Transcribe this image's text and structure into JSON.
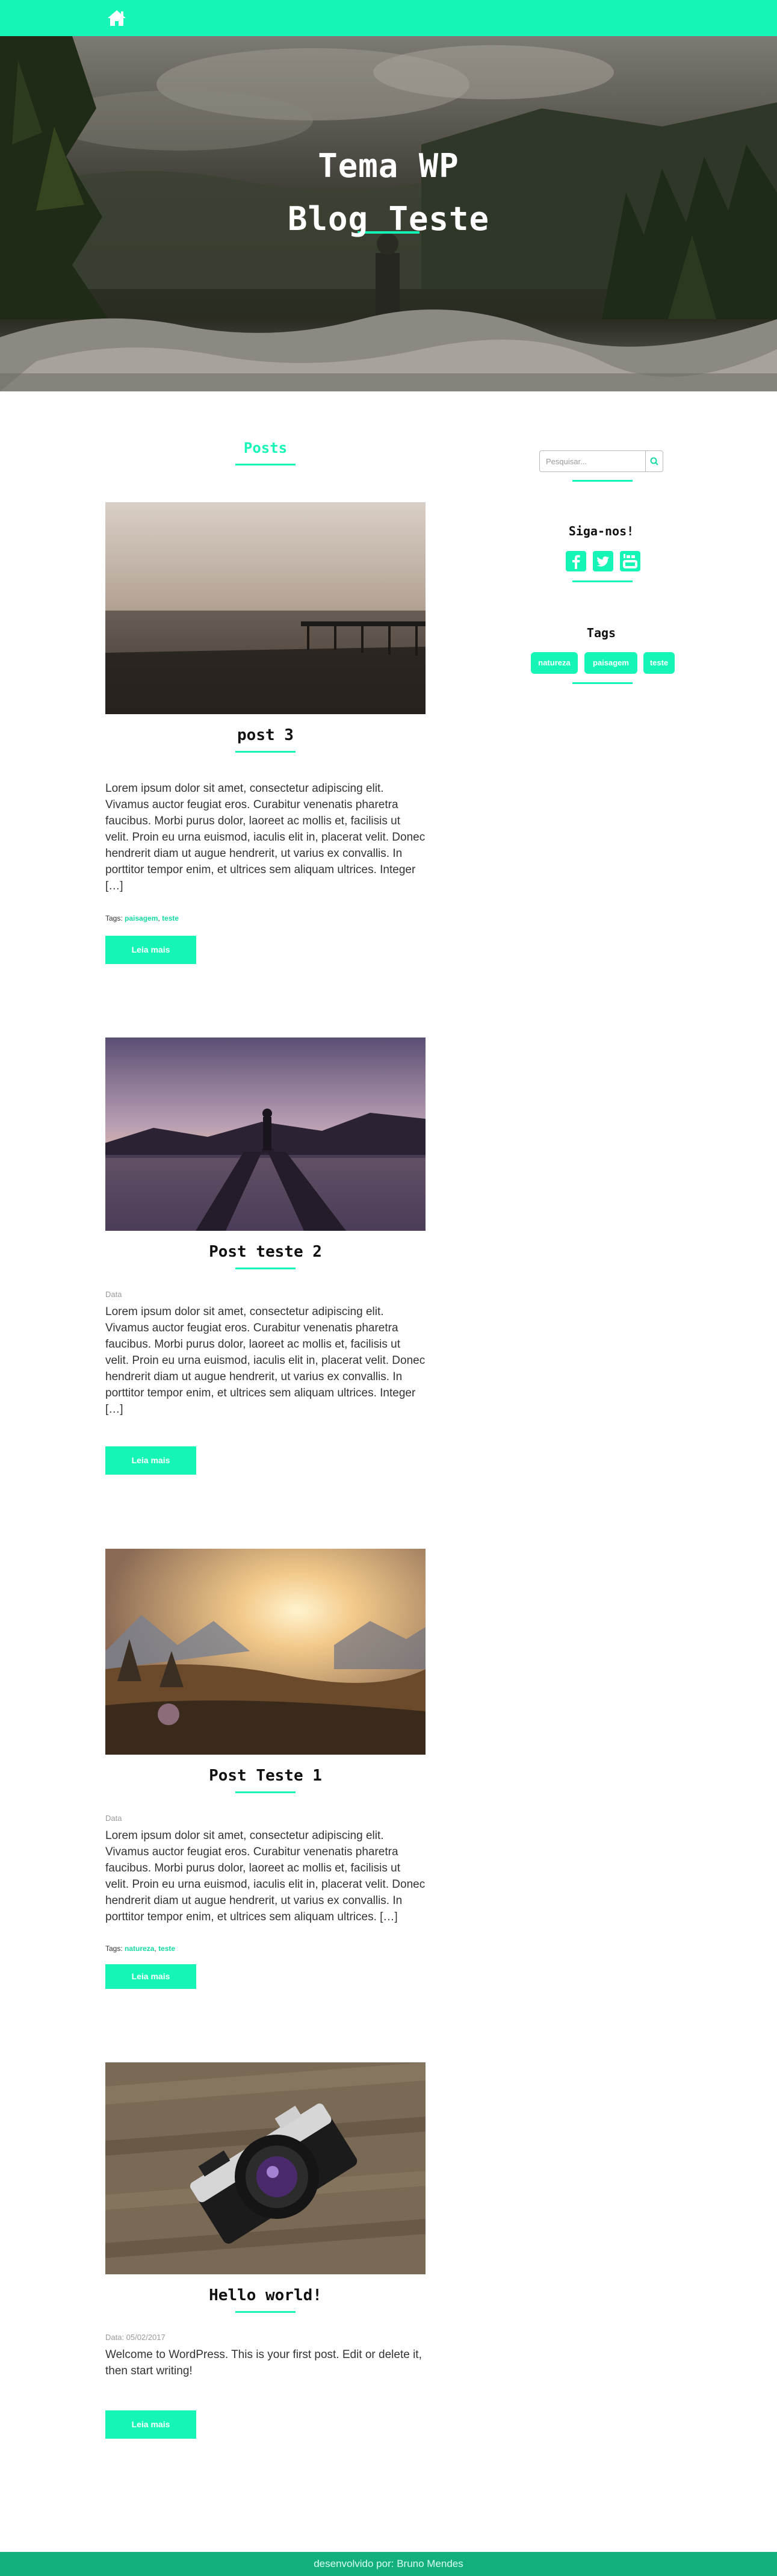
{
  "nav": {
    "home_icon": "home-icon",
    "accent": "#14f5b6"
  },
  "hero": {
    "title_line1": "Tema WP",
    "title_line2": "Blog Teste"
  },
  "posts_section": {
    "heading": "Posts"
  },
  "posts": [
    {
      "title": "post 3",
      "date": "",
      "excerpt": "Lorem ipsum dolor sit amet, consectetur adipiscing elit. Vivamus auctor feugiat eros. Curabitur venenatis pharetra faucibus. Morbi purus dolor, laoreet ac mollis et, facilisis ut velit. Proin eu urna euismod, iaculis elit in, placerat velit. Donec hendrerit diam ut augue hendrerit, ut varius ex convallis. In porttitor tempor enim, et ultrices sem aliquam ultrices. Integer […]",
      "tags_label": "Tags:",
      "tags": [
        "paisagem",
        "teste"
      ],
      "read_more": "Leia mais"
    },
    {
      "title": "Post teste 2",
      "date": "Data",
      "excerpt": "Lorem ipsum dolor sit amet, consectetur adipiscing elit. Vivamus auctor feugiat eros. Curabitur venenatis pharetra faucibus. Morbi purus dolor, laoreet ac mollis et, facilisis ut velit. Proin eu urna euismod, iaculis elit in, placerat velit. Donec hendrerit diam ut augue hendrerit, ut varius ex convallis. In porttitor tempor enim, et ultrices sem aliquam ultrices. Integer […]",
      "tags_label": "",
      "tags": [],
      "read_more": "Leia mais"
    },
    {
      "title": "Post Teste 1",
      "date": "Data",
      "excerpt": "Lorem ipsum dolor sit amet, consectetur adipiscing elit. Vivamus auctor feugiat eros. Curabitur venenatis pharetra faucibus. Morbi purus dolor, laoreet ac mollis et, facilisis ut velit. Proin eu urna euismod, iaculis elit in, placerat velit. Donec hendrerit diam ut augue hendrerit, ut varius ex convallis.  In porttitor tempor enim, et ultrices sem aliquam ultrices. […]",
      "tags_label": "Tags:",
      "tags": [
        "natureza",
        "teste"
      ],
      "read_more": "Leia mais"
    },
    {
      "title": "Hello world!",
      "date": "Data: 05/02/2017",
      "excerpt": "Welcome to WordPress. This is your first post. Edit or delete it, then start writing!",
      "tags_label": "",
      "tags": [],
      "read_more": "Leia mais"
    }
  ],
  "sidebar": {
    "search": {
      "placeholder": "Pesquisar...",
      "icon": "search-icon"
    },
    "follow": {
      "heading": "Siga-nos!",
      "icons": [
        "facebook-icon",
        "twitter-icon",
        "youtube-icon"
      ]
    },
    "tags": {
      "heading": "Tags",
      "items": [
        "natureza",
        "paisagem",
        "teste"
      ]
    }
  },
  "footer": {
    "text": "desenvolvido por: Bruno Mendes",
    "color": "#13b07e"
  }
}
